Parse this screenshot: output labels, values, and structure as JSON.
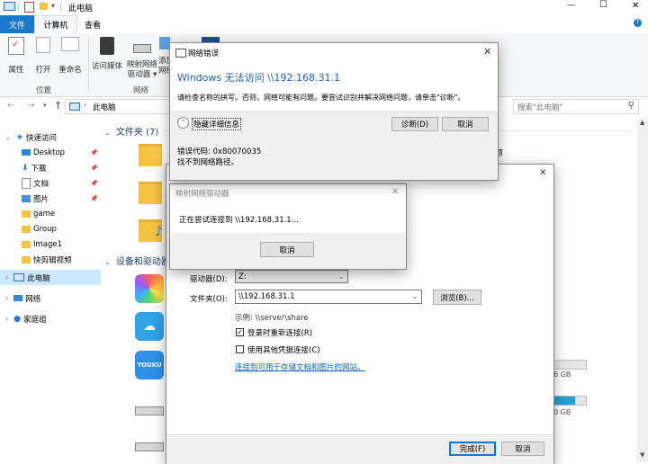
{
  "window": {
    "title": "此电脑",
    "controls": {
      "minimize": "—",
      "maximize": "☐",
      "close": "✕"
    }
  },
  "ribbon": {
    "tabs": [
      {
        "label": "文件",
        "active_file": true
      },
      {
        "label": "计算机",
        "selected": true
      },
      {
        "label": "查看"
      }
    ],
    "location_group": {
      "label": "位置",
      "buttons": [
        "属性",
        "打开",
        "重命名"
      ]
    },
    "network_group": {
      "label": "网络",
      "buttons": [
        "访问媒体",
        "映射网络\n驱动器 ▾",
        "添加\n网络"
      ]
    }
  },
  "address_bar": {
    "path": "此电脑",
    "search_placeholder": "搜索\"此电脑\""
  },
  "sidebar": {
    "quick_access": "快速访问",
    "items": [
      {
        "label": "Desktop",
        "pinned": true
      },
      {
        "label": "下载",
        "pinned": true
      },
      {
        "label": "文档",
        "pinned": true
      },
      {
        "label": "图片",
        "pinned": true
      },
      {
        "label": "game"
      },
      {
        "label": "Group"
      },
      {
        "label": "Image1"
      },
      {
        "label": "快剪辑视频"
      }
    ],
    "this_pc": "此电脑",
    "network": "网络",
    "homegroup": "家庭组"
  },
  "content": {
    "folders_header": "文件夹 (7)",
    "devices_header": "设备和驱动器",
    "partial_right_text": "频",
    "drive_sizes": [
      "46 GB",
      "50 GB"
    ],
    "app_labels": [
      "YOUKU"
    ]
  },
  "map_drive_dialog": {
    "drive_label": "驱动器(D):",
    "drive_value": "Z:",
    "folder_label": "文件夹(O):",
    "folder_value": "\\\\192.168.31.1",
    "browse_button": "浏览(B)...",
    "example": "示例: \\\\server\\share",
    "reconnect_label": "登录时重新连接(R)",
    "reconnect_checked": true,
    "other_creds_label": "使用其他凭据连接(C)",
    "other_creds_checked": false,
    "link": "连接到可用于存储文档和图片的网站。",
    "finish_button": "完成(F)",
    "cancel_button": "取消"
  },
  "connecting_dialog": {
    "title": "映射网络驱动器",
    "message": "正在尝试连接到 \\\\192.168.31.1...",
    "cancel_button": "取消"
  },
  "network_error_dialog": {
    "title": "网络错误",
    "heading": "Windows 无法访问 \\\\192.168.31.1",
    "message": "请检查名称的拼写。否则，网络可能有问题。要尝试识别并解决网络问题，请单击\"诊断\"。",
    "hide_details": "隐藏详细信息",
    "diagnose_button": "诊断(D)",
    "cancel_button": "取消",
    "error_code": "错误代码: 0x80070035",
    "error_text": "找不到网络路径。"
  },
  "colors": {
    "accent": "#0078d7",
    "heading_blue": "#1a5fb4",
    "link_blue": "#0066cc",
    "folder_yellow": "#f5c445"
  }
}
